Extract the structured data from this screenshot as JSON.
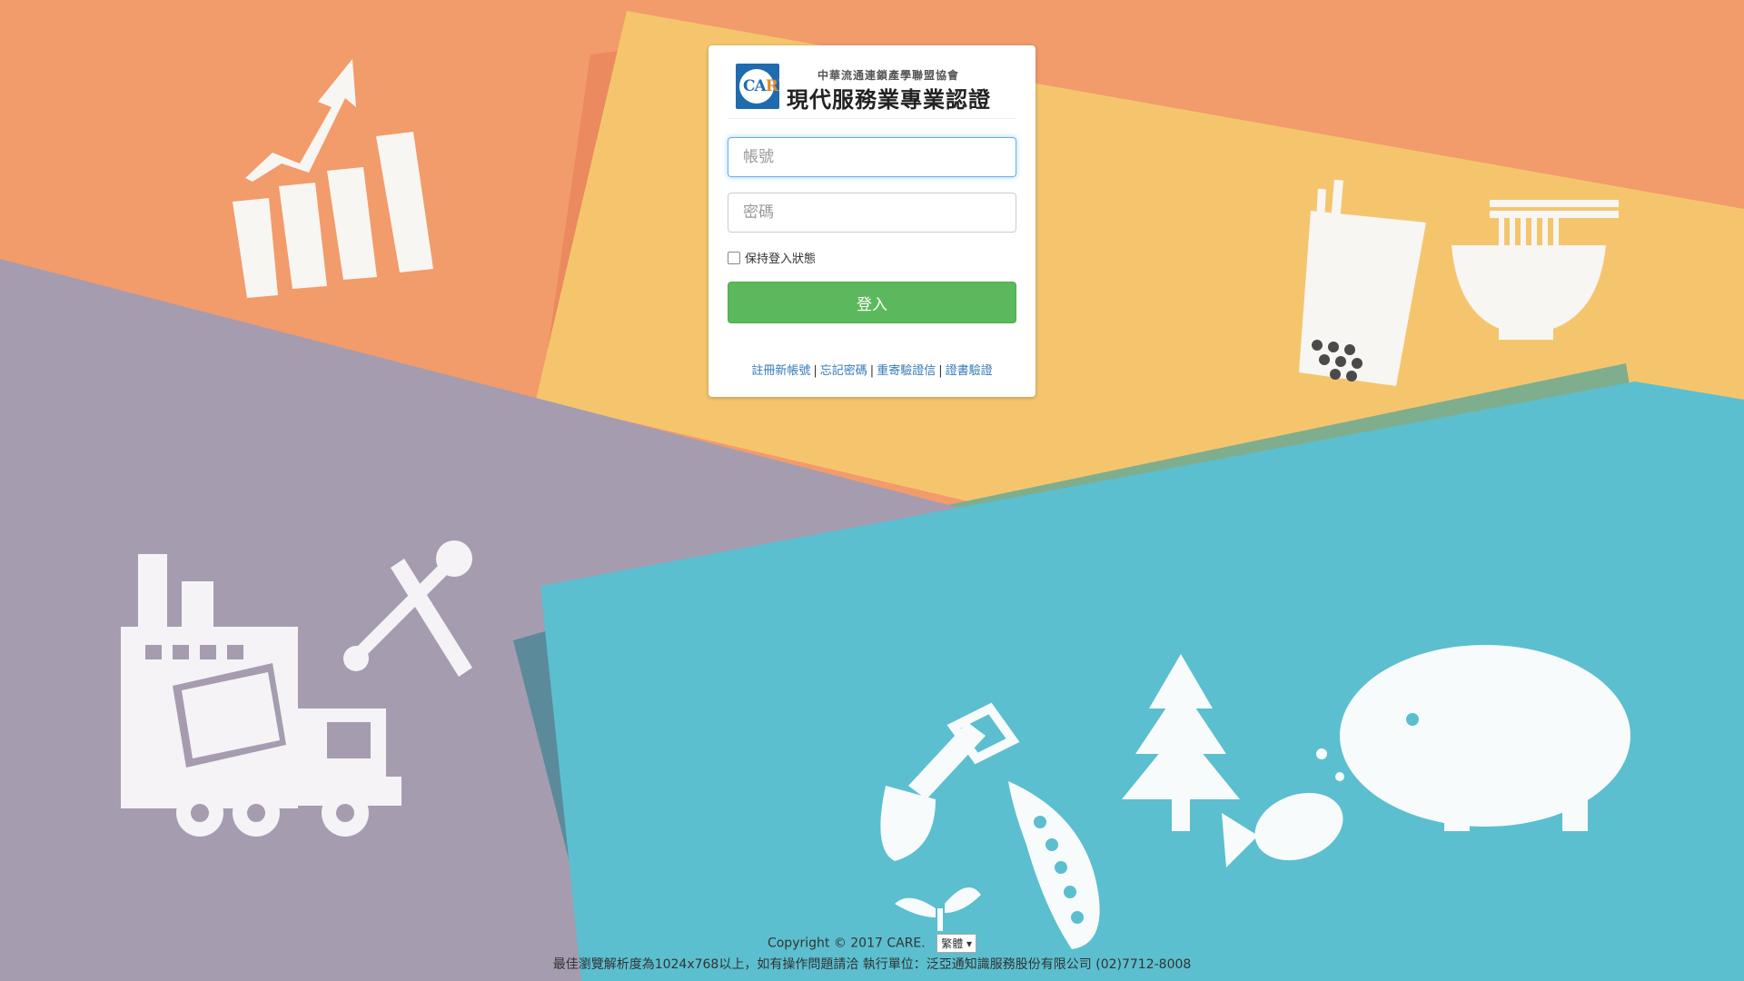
{
  "brand": {
    "logo_text_ca": "CA",
    "logo_text_re": "RE",
    "association": "中華流通連鎖產學聯盟協會",
    "title": "現代服務業專業認證"
  },
  "form": {
    "account_placeholder": "帳號",
    "password_placeholder": "密碼",
    "remember_label": "保持登入狀態",
    "login_label": "登入"
  },
  "links": [
    {
      "label": "註冊新帳號"
    },
    {
      "label": "忘記密碼"
    },
    {
      "label": "重寄驗證信"
    },
    {
      "label": "證書驗證"
    }
  ],
  "footer": {
    "copyright": "Copyright © 2017 CARE.",
    "language": "繁體 ▾",
    "info": "最佳瀏覽解析度為1024x768以上，如有操作問題請洽 執行單位：泛亞通知識服務股份有限公司 (02)7712-8008"
  },
  "colors": {
    "orange": "#f29b6b",
    "yellow": "#f5c56e",
    "purple": "#a59cb0",
    "teal": "#5bbfcf",
    "green_button": "#5cb85c",
    "link_blue": "#337ab7"
  }
}
